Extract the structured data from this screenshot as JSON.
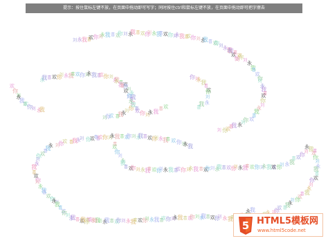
{
  "hint_bar": {
    "text": "提示：按住鼠标左键不放，在页面中拖动即可写字；同时按住ctrl和鼠标左键不放，在页面中拖动即可把字擦去"
  },
  "trail": {
    "words": [
      "刘",
      "永",
      "我",
      "喜",
      "欢",
      "你"
    ],
    "colors": [
      "#a8a8e0",
      "#e8a0d8",
      "#a0d0a8",
      "#e0c080",
      "#90c8e8",
      "#c0a0e0",
      "#e8b0b0",
      "#a0e0d0",
      "#d0d090",
      "#b0b8f0",
      "#f0a0c0",
      "#98d898"
    ],
    "dark_color": "#666666"
  },
  "logo": {
    "brand": "HTML5模板网",
    "url": "www.html5code.net",
    "badge_number": "5",
    "shield_color": "#e44d26",
    "shield_highlight": "#f16529"
  }
}
